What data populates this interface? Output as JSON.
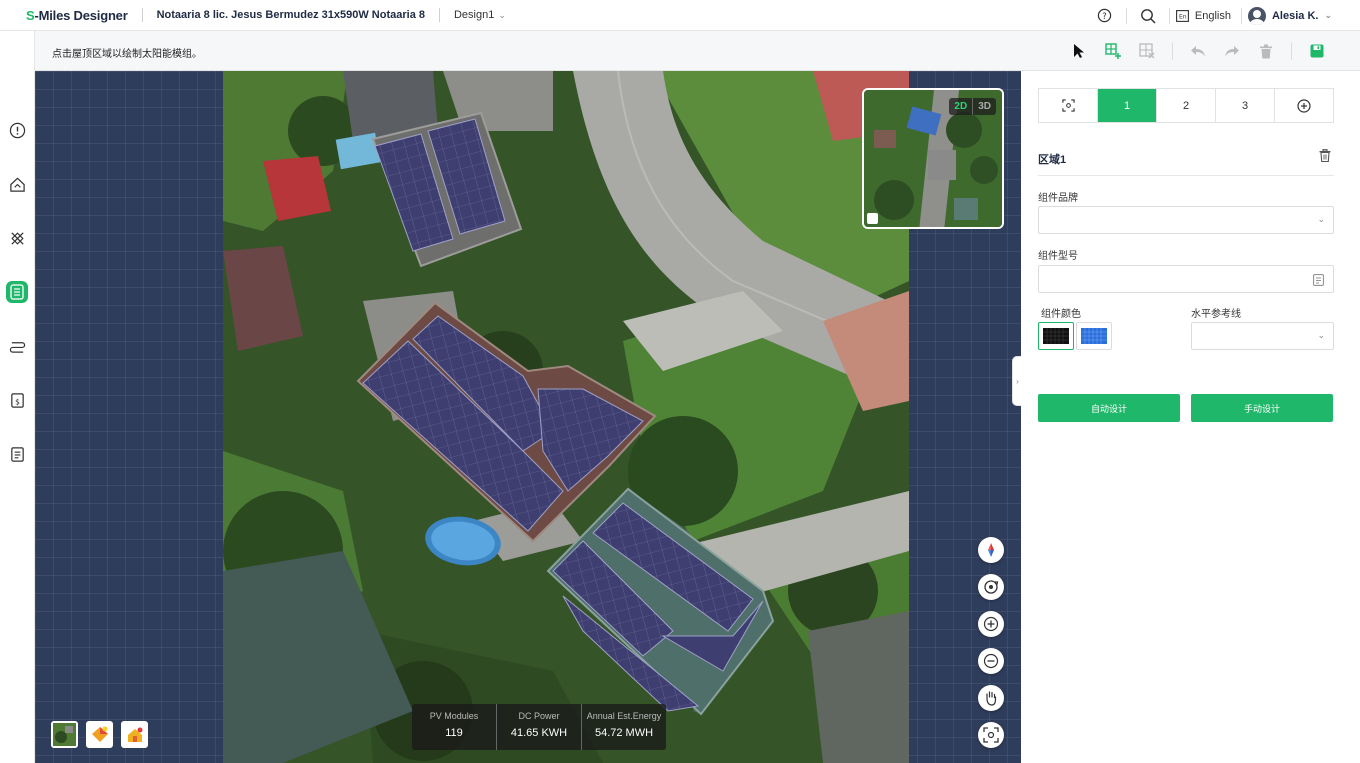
{
  "header": {
    "logo_s": "S",
    "logo_rest": "-Miles Designer",
    "project": "Notaaria 8 lic. Jesus Bermudez 31x590W Notaaria 8",
    "design": "Design1",
    "language": "English",
    "user": "Alesia K."
  },
  "toolbar": {
    "hint": "点击屋顶区域以绘制太阳能模组。"
  },
  "minimap": {
    "mode_2d": "2D",
    "mode_3d": "3D",
    "active": "2D"
  },
  "stats": [
    {
      "label": "PV Modules",
      "value": "119"
    },
    {
      "label": "DC Power",
      "value": "41.65 KWH"
    },
    {
      "label": "Annual Est.Energy",
      "value": "54.72 MWH"
    }
  ],
  "panel": {
    "tabs": [
      "1",
      "2",
      "3"
    ],
    "active_tab": "1",
    "area_title": "区域1",
    "brand_label": "组件品牌",
    "model_label": "组件型号",
    "color_label": "组件颜色",
    "ref_line_label": "水平参考线",
    "auto_btn": "自动设计",
    "manual_btn": "手动设计"
  },
  "colors": {
    "accent": "#1fb86a",
    "canvas_bg": "#2f3d5c",
    "panel_fill": "#3e3f70"
  }
}
